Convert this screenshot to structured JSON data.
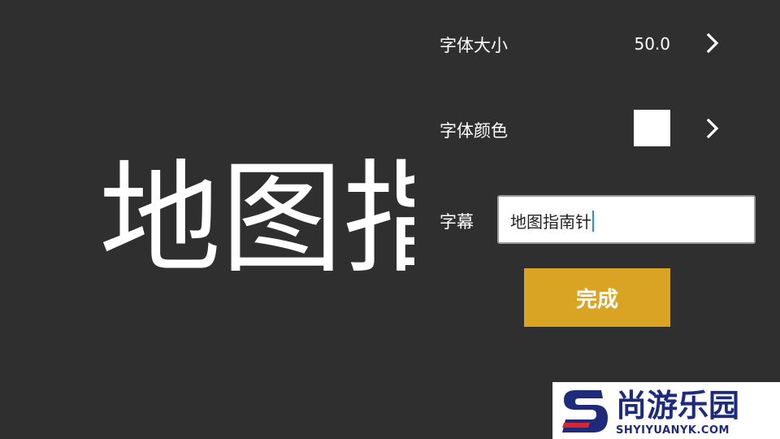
{
  "preview": {
    "text": "地图指"
  },
  "font_size": {
    "label": "字体大小",
    "value": "50.0",
    "icon": "chevron-right-icon"
  },
  "font_color": {
    "label": "字体颜色",
    "swatch_color": "#ffffff",
    "icon": "chevron-right-icon"
  },
  "caption": {
    "label": "字幕",
    "value": "地图指南针"
  },
  "done_button": {
    "label": "完成",
    "color": "#d9a424"
  },
  "watermark": {
    "title": "尚游乐园",
    "url": "SHYIYUANYK.COM"
  }
}
